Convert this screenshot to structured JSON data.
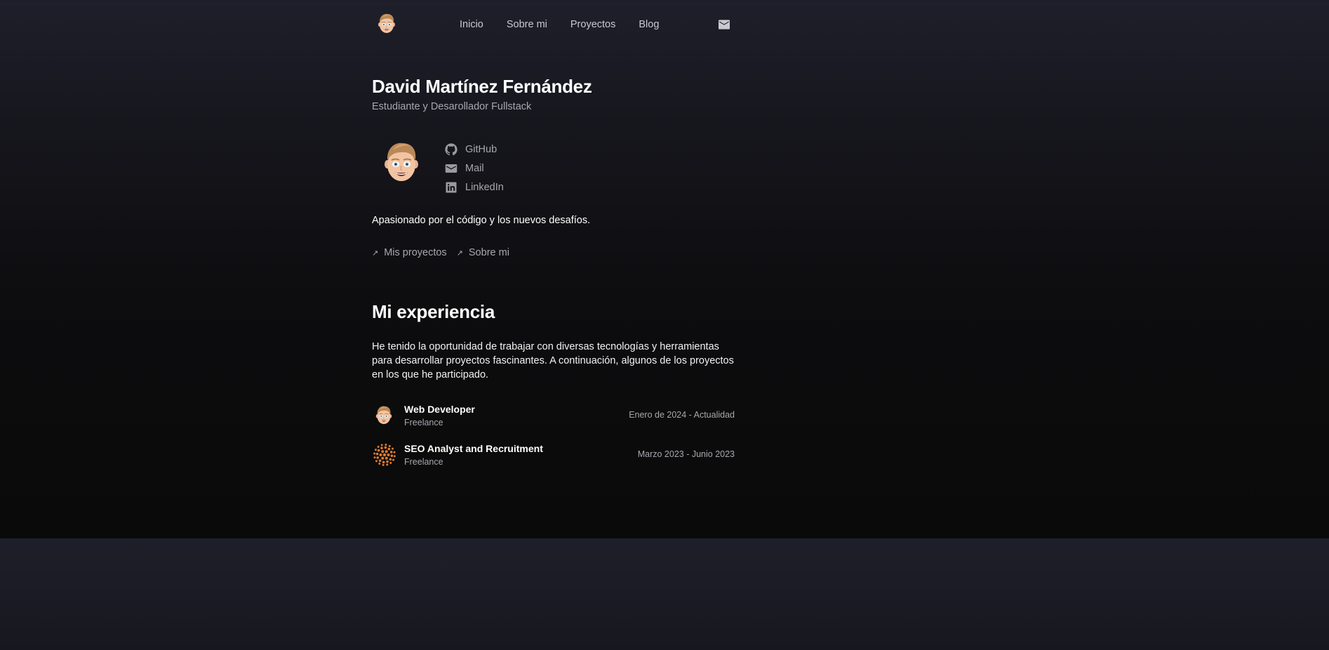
{
  "nav": {
    "items": [
      {
        "label": "Inicio"
      },
      {
        "label": "Sobre mi"
      },
      {
        "label": "Proyectos"
      },
      {
        "label": "Blog"
      }
    ],
    "mail_icon": "mail-icon"
  },
  "hero": {
    "name": "David Martínez Fernández",
    "subtitle": "Estudiante y Desarollador Fullstack",
    "avatar_icon": "memoji-avatar",
    "social": [
      {
        "label": "GitHub",
        "icon": "github-icon"
      },
      {
        "label": "Mail",
        "icon": "mail-icon"
      },
      {
        "label": "LinkedIn",
        "icon": "linkedin-icon"
      }
    ],
    "bio": "Apasionado por el código y los nuevos desafíos.",
    "cta": [
      {
        "label": "Mis proyectos",
        "icon": "arrow-up-right-icon"
      },
      {
        "label": "Sobre mi",
        "icon": "arrow-up-right-icon"
      }
    ]
  },
  "experience": {
    "title": "Mi experiencia",
    "intro": "He tenido la oportunidad de trabajar con diversas tecnologías y herramientas para desarrollar proyectos fascinantes. A continuación, algunos de los proyectos en los que he participado.",
    "items": [
      {
        "role": "Web Developer",
        "company": "Freelance",
        "dates": "Enero de 2024 - Actualidad",
        "icon": "memoji-avatar"
      },
      {
        "role": "SEO Analyst and Recruitment",
        "company": "Freelance",
        "dates": "Marzo 2023 - Junio 2023",
        "icon": "orange-dots-logo"
      }
    ]
  },
  "colors": {
    "background_top": "#1f1f2b",
    "background_bottom": "#0a0a0a",
    "text_primary": "#ffffff",
    "text_muted": "#a7a7ae",
    "accent_orange": "#e07a2e"
  }
}
